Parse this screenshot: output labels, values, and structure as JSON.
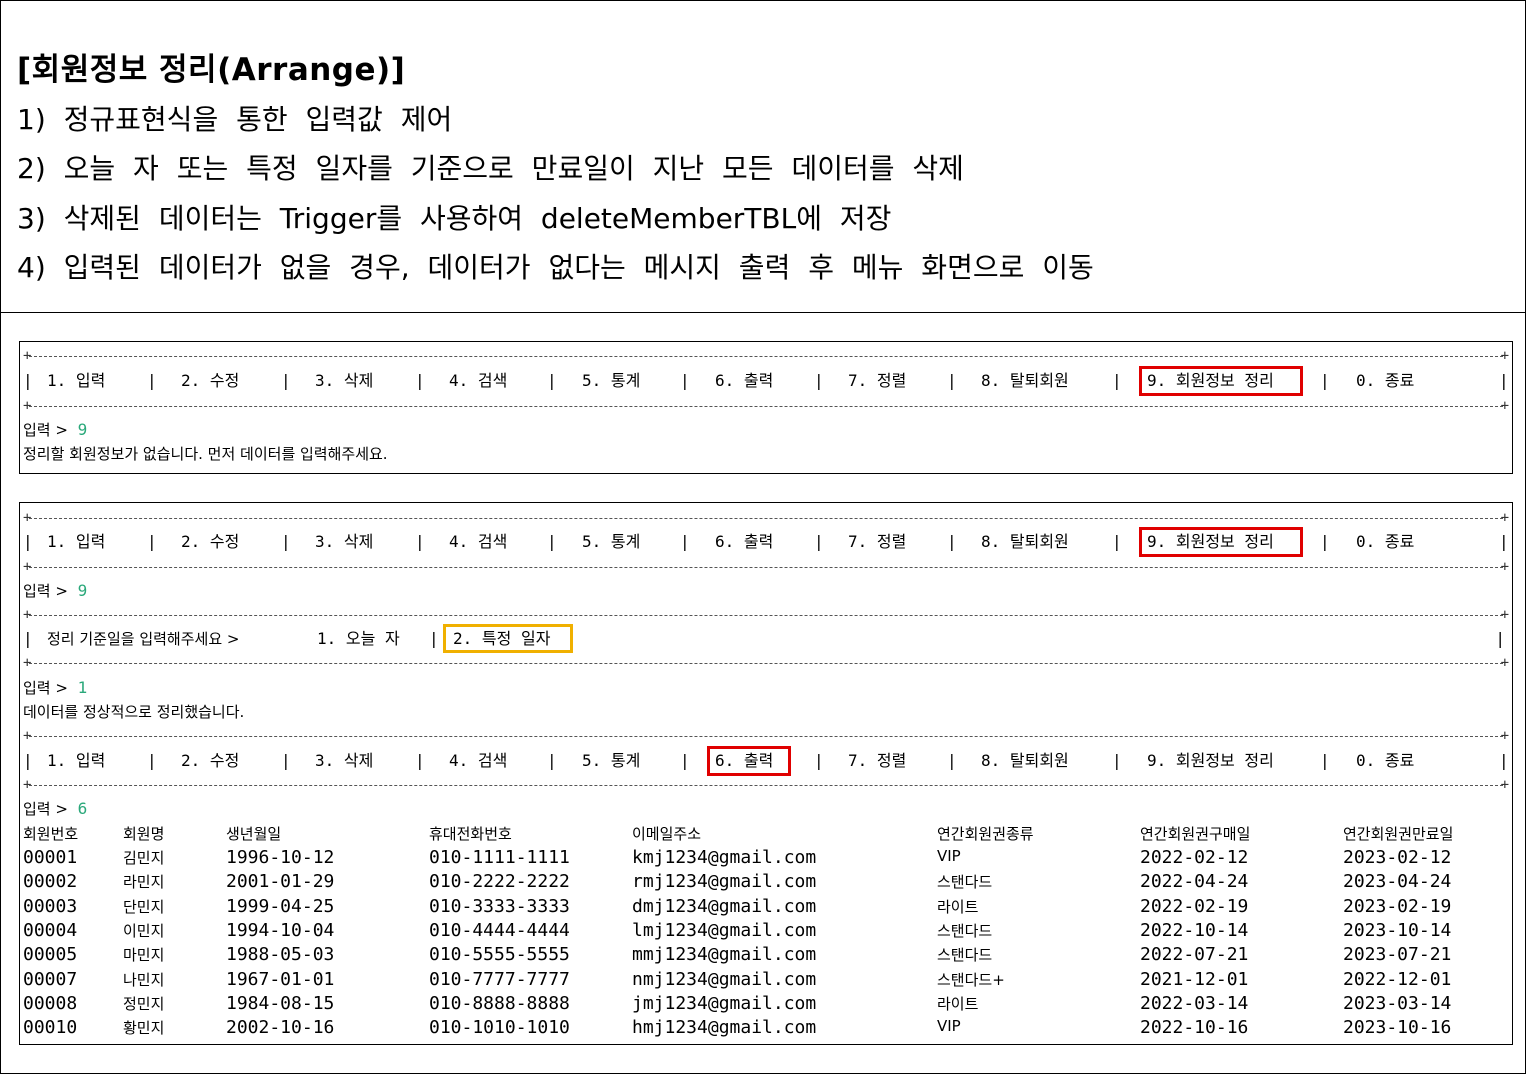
{
  "title": "[회원정보 정리(Arrange)]",
  "requirements": [
    "1) 정규표현식을 통한 입력값 제어",
    "2) 오늘 자 또는 특정 일자를 기준으로 만료일이 지난 모든 데이터를 삭제",
    "3) 삭제된 데이터는 Trigger를 사용하여 deleteMemberTBL에 저장",
    "4) 입력된 데이터가 없을 경우, 데이터가 없다는 메시지 출력 후 메뉴 화면으로 이동"
  ],
  "menu": {
    "items": [
      "1. 입력",
      "2. 수정",
      "3. 삭제",
      "4. 검색",
      "5. 통계",
      "6. 출력",
      "7. 정렬",
      "8. 탈퇴회원",
      "9. 회원정보 정리",
      "0. 종료"
    ],
    "pipe": "|",
    "corner": "+"
  },
  "panel1": {
    "prompt_label": "입력 >",
    "prompt_value": "9",
    "message": "정리할 회원정보가 없습니다. 먼저 데이터를 입력해주세요."
  },
  "panel2": {
    "prompt1_label": "입력 >",
    "prompt1_value": "9",
    "submenu_label": "정리 기준일을 입력해주세요 >",
    "submenu_opt1": "1. 오늘 자",
    "submenu_opt2": "2. 특정 일자",
    "prompt2_label": "입력 >",
    "prompt2_value": "1",
    "result_message": "데이터를 정상적으로 정리했습니다.",
    "prompt3_label": "입력 >",
    "prompt3_value": "6"
  },
  "table": {
    "headers": [
      "회원번호",
      "회원명",
      "생년월일",
      "휴대전화번호",
      "이메일주소",
      "연간회원권종류",
      "연간회원권구매일",
      "연간회원권만료일"
    ],
    "rows": [
      [
        "00001",
        "김민지",
        "1996-10-12",
        "010-1111-1111",
        "kmj1234@gmail.com",
        "VIP",
        "2022-02-12",
        "2023-02-12"
      ],
      [
        "00002",
        "라민지",
        "2001-01-29",
        "010-2222-2222",
        "rmj1234@gmail.com",
        "스탠다드",
        "2022-04-24",
        "2023-04-24"
      ],
      [
        "00003",
        "단민지",
        "1999-04-25",
        "010-3333-3333",
        "dmj1234@gmail.com",
        "라이트",
        "2022-02-19",
        "2023-02-19"
      ],
      [
        "00004",
        "이민지",
        "1994-10-04",
        "010-4444-4444",
        "lmj1234@gmail.com",
        "스탠다드",
        "2022-10-14",
        "2023-10-14"
      ],
      [
        "00005",
        "마민지",
        "1988-05-03",
        "010-5555-5555",
        "mmj1234@gmail.com",
        "스탠다드",
        "2022-07-21",
        "2023-07-21"
      ],
      [
        "00007",
        "나민지",
        "1967-01-01",
        "010-7777-7777",
        "nmj1234@gmail.com",
        "스탠다드+",
        "2021-12-01",
        "2022-12-01"
      ],
      [
        "00008",
        "정민지",
        "1984-08-15",
        "010-8888-8888",
        "jmj1234@gmail.com",
        "라이트",
        "2022-03-14",
        "2023-03-14"
      ],
      [
        "00010",
        "황민지",
        "2002-10-16",
        "010-1010-1010",
        "hmj1234@gmail.com",
        "VIP",
        "2022-10-16",
        "2023-10-16"
      ]
    ]
  },
  "colors": {
    "highlight_red": "#e00000",
    "highlight_yellow": "#f0b000",
    "input_cyan": "#2aa87a"
  }
}
